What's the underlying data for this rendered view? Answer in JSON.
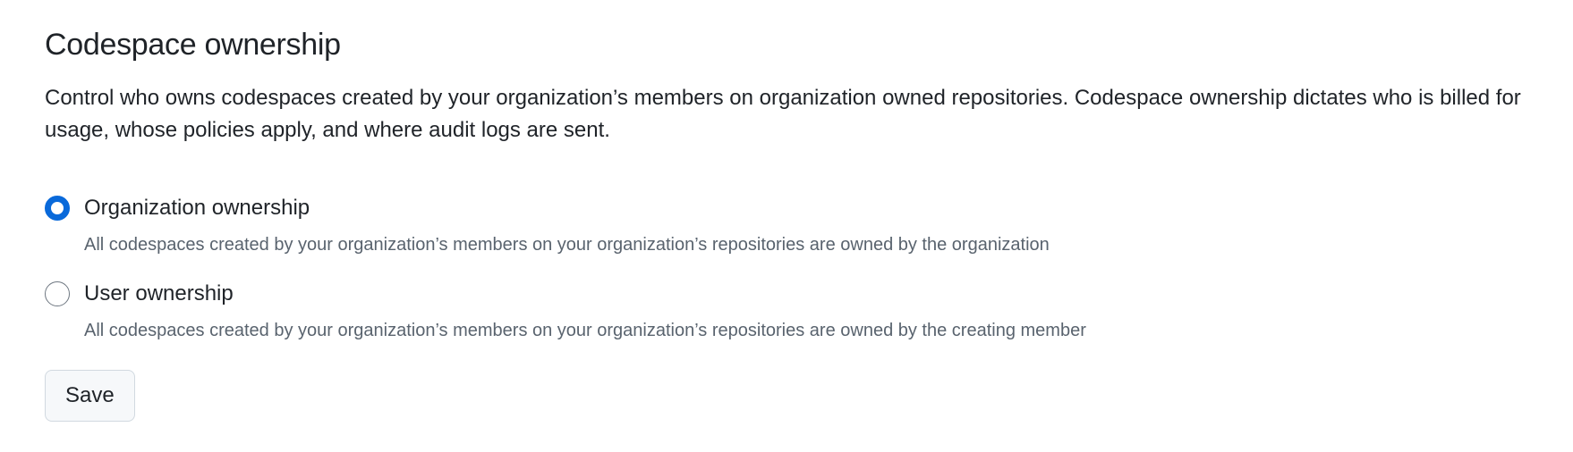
{
  "section": {
    "title": "Codespace ownership",
    "description": "Control who owns codespaces created by your organization’s members on organization owned repositories. Codespace ownership dictates who is billed for usage, whose policies apply, and where audit logs are sent."
  },
  "options": [
    {
      "label": "Organization ownership",
      "note": "All codespaces created by your organization’s members on your organization’s repositories are owned by the organization",
      "selected": true
    },
    {
      "label": "User ownership",
      "note": "All codespaces created by your organization’s members on your organization’s repositories are owned by the creating member",
      "selected": false
    }
  ],
  "actions": {
    "save_label": "Save"
  },
  "colors": {
    "accent": "#0969da",
    "text": "#1f2328",
    "muted": "#59636e",
    "button_bg": "#f6f8fa",
    "button_border": "#d1d9e0"
  }
}
